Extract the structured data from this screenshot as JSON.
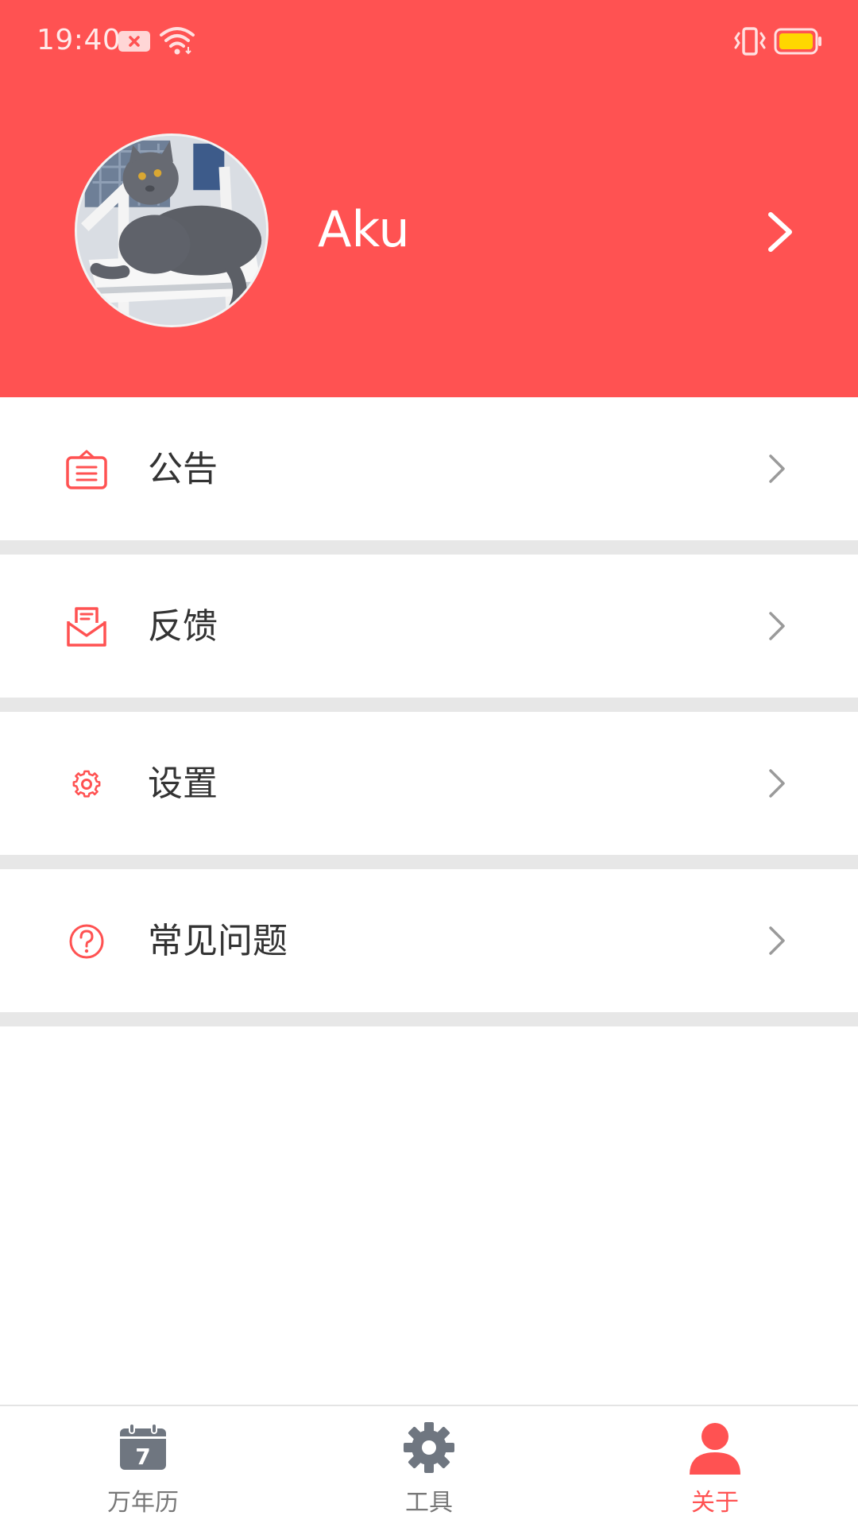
{
  "colors": {
    "accent": "#ff5252",
    "divider": "#e7e7e7",
    "text": "#333333",
    "tab_inactive": "#777777",
    "chevron": "#9a9a9a"
  },
  "status_bar": {
    "time": "19:40",
    "icons": [
      "notification-icon",
      "wifi-icon",
      "vibrate-icon",
      "battery-icon"
    ]
  },
  "profile": {
    "name": "Aku",
    "avatar_icon": "avatar-cat-photo"
  },
  "menu": {
    "items": [
      {
        "label": "公告",
        "icon": "notice-icon"
      },
      {
        "label": "反馈",
        "icon": "feedback-mail-icon"
      },
      {
        "label": "设置",
        "icon": "gear-icon"
      },
      {
        "label": "常见问题",
        "icon": "question-icon"
      }
    ]
  },
  "tabs": [
    {
      "label": "万年历",
      "icon": "calendar-icon",
      "calendar_day": "7",
      "active": false
    },
    {
      "label": "工具",
      "icon": "gear-icon",
      "active": false
    },
    {
      "label": "关于",
      "icon": "person-icon",
      "active": true
    }
  ]
}
